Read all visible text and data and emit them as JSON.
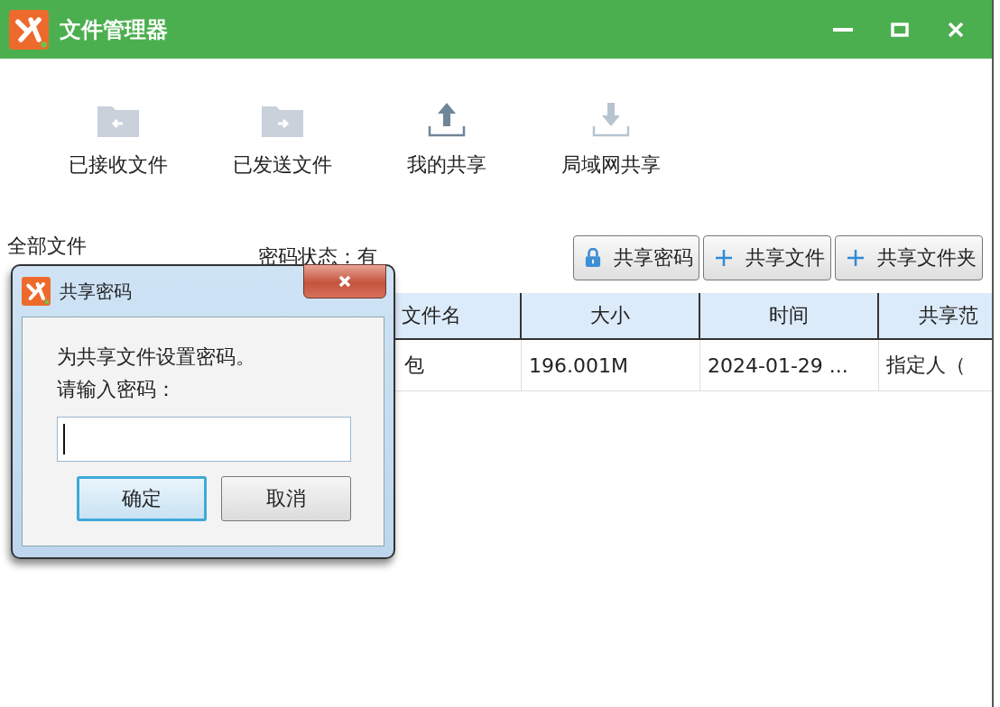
{
  "window": {
    "title": "文件管理器"
  },
  "toolbar": [
    {
      "label": "已接收文件",
      "kind": "received"
    },
    {
      "label": "已发送文件",
      "kind": "sent"
    },
    {
      "label": "我的共享",
      "kind": "share"
    },
    {
      "label": "局域网共享",
      "kind": "lan"
    }
  ],
  "sidebar": {
    "title": "全部文件"
  },
  "password_status": "密码状态：有",
  "actions": [
    {
      "label": "共享密码",
      "kind": "password"
    },
    {
      "label": "共享文件",
      "kind": "add"
    },
    {
      "label": "共享文件夹",
      "kind": "add"
    }
  ],
  "table": {
    "columns": [
      "文件名",
      "大小",
      "时间",
      "共享范"
    ],
    "rows": [
      [
        "包",
        "196.001M",
        "2024-01-29 ...",
        "指定人（"
      ]
    ]
  },
  "dialog": {
    "title": "共享密码",
    "message": "为共享文件设置密码。",
    "prompt": "请输入密码：",
    "buttons": [
      {
        "label": "确定",
        "default": true
      },
      {
        "label": "取消",
        "default": false
      }
    ]
  }
}
